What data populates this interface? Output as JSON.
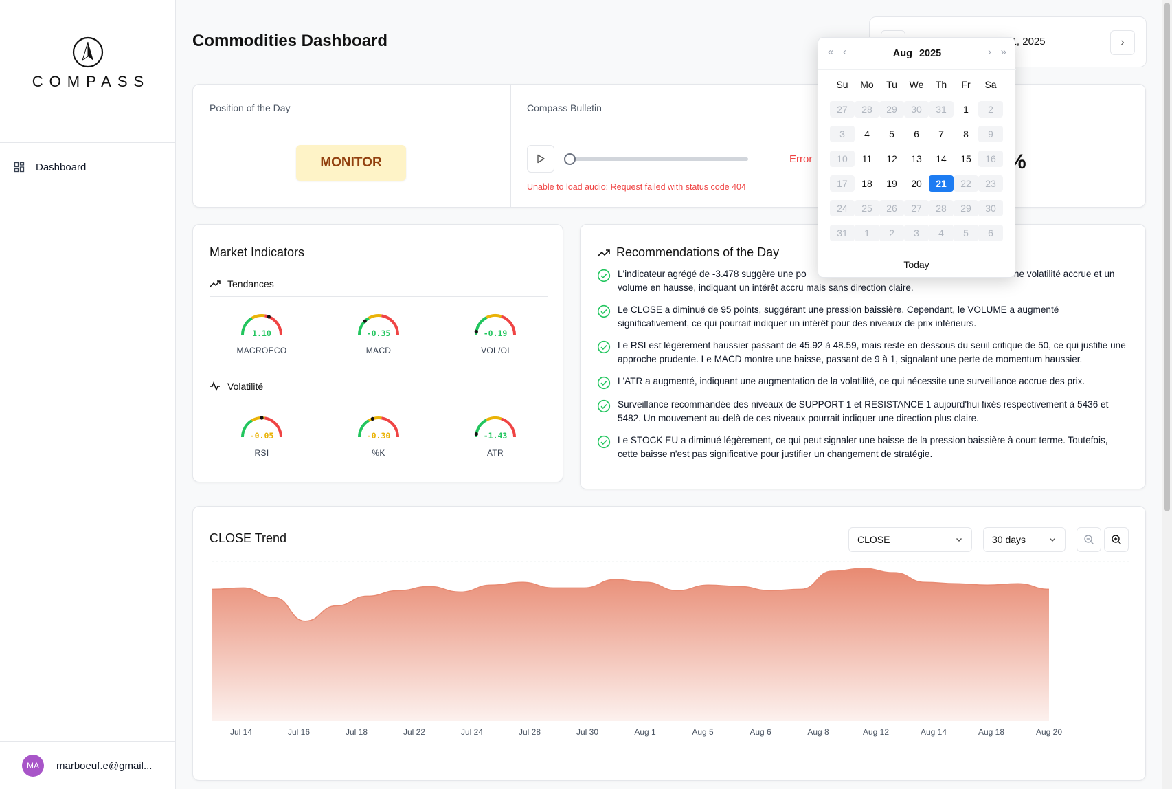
{
  "sidebar": {
    "brand": "COMPASS",
    "nav": [
      {
        "label": "Dashboard",
        "icon": "dashboard-grid-icon"
      }
    ],
    "user": {
      "initials": "MA",
      "email": "marboeuf.e@gmail..."
    }
  },
  "header": {
    "title": "Commodities Dashboard",
    "date": "August 21, 2025"
  },
  "top": {
    "position_label": "Position of the Day",
    "position_value": "MONITOR",
    "bulletin_label": "Compass Bulletin",
    "audio_status": "Error",
    "audio_error": "Unable to load audio: Request failed with status code 404",
    "partial_value": "%"
  },
  "market": {
    "title": "Market Indicators",
    "sections": [
      {
        "title": "Tendances",
        "icon": "trend-up-icon",
        "gauges": [
          {
            "label": "MACROECO",
            "value": "1.10",
            "level": 0.62,
            "color": "#22c55e"
          },
          {
            "label": "MACD",
            "value": "-0.35",
            "level": 0.25,
            "color": "#22c55e"
          },
          {
            "label": "VOL/OI",
            "value": "-0.19",
            "level": 0.05,
            "color": "#22c55e"
          }
        ]
      },
      {
        "title": "Volatilité",
        "icon": "activity-icon",
        "gauges": [
          {
            "label": "RSI",
            "value": "-0.05",
            "level": 0.5,
            "color": "#eab308"
          },
          {
            "label": "%K",
            "value": "-0.30",
            "level": 0.4,
            "color": "#eab308"
          },
          {
            "label": "ATR",
            "value": "-1.43",
            "level": 0.05,
            "color": "#22c55e"
          }
        ]
      }
    ]
  },
  "recommendations": {
    "title": "Recommendations of the Day",
    "items": [
      "L'indicateur agrégé de -3.478 suggère une po                                                données montrent une volatilité accrue et un volume en hausse, indiquant un intérêt accru mais sans direction claire.",
      "Le CLOSE a diminué de 95 points, suggérant une pression baissière. Cependant, le VOLUME a augmenté significativement, ce qui pourrait indiquer un intérêt pour des niveaux de prix inférieurs.",
      "Le RSI est légèrement haussier passant de 45.92 à 48.59, mais reste en dessous du seuil critique de 50, ce qui justifie une approche prudente. Le MACD montre une baisse, passant de 9 à 1, signalant une perte de momentum haussier.",
      "L'ATR a augmenté, indiquant une augmentation de la volatilité, ce qui nécessite une surveillance accrue des prix.",
      "Surveillance recommandée des niveaux de SUPPORT 1 et RESISTANCE 1 aujourd'hui fixés respectivement à 5436 et 5482. Un mouvement au-delà de ces niveaux pourrait indiquer une direction plus claire.",
      "Le STOCK EU a diminué légèrement, ce qui peut signaler une baisse de la pression baissière à court terme. Toutefois, cette baisse n'est pas significative pour justifier un changement de stratégie."
    ]
  },
  "trend": {
    "title": "CLOSE Trend",
    "metric": "CLOSE",
    "range": "30 days"
  },
  "chart_data": {
    "type": "area",
    "x": [
      "Jul 14",
      "Jul 15",
      "Jul 16",
      "Jul 17",
      "Jul 18",
      "Jul 21",
      "Jul 22",
      "Jul 23",
      "Jul 24",
      "Jul 25",
      "Jul 28",
      "Jul 29",
      "Jul 30",
      "Jul 31",
      "Aug 1",
      "Aug 4",
      "Aug 5",
      "Aug 6",
      "Aug 7",
      "Aug 8",
      "Aug 11",
      "Aug 12",
      "Aug 13",
      "Aug 14",
      "Aug 15",
      "Aug 18",
      "Aug 19",
      "Aug 20"
    ],
    "tick_labels": [
      "Jul 14",
      "Jul 16",
      "Jul 18",
      "Jul 22",
      "Jul 24",
      "Jul 28",
      "Jul 30",
      "Aug 1",
      "Aug 5",
      "Aug 6",
      "Aug 8",
      "Aug 12",
      "Aug 14",
      "Aug 18",
      "Aug 20"
    ],
    "values": [
      5475,
      5476,
      5469,
      5452,
      5463,
      5470,
      5474,
      5477,
      5473,
      5478,
      5480,
      5476,
      5476,
      5482,
      5480,
      5474,
      5478,
      5477,
      5474,
      5475,
      5488,
      5490,
      5487,
      5480,
      5479,
      5478,
      5479,
      5475
    ],
    "ylim": [
      5380,
      5495
    ],
    "color": "#e88a72",
    "grid": false
  },
  "calendar": {
    "month": "Aug",
    "year": "2025",
    "dow": [
      "Su",
      "Mo",
      "Tu",
      "We",
      "Th",
      "Fr",
      "Sa"
    ],
    "weeks": [
      [
        {
          "d": "27",
          "s": "out"
        },
        {
          "d": "28",
          "s": "out"
        },
        {
          "d": "29",
          "s": "out"
        },
        {
          "d": "30",
          "s": "out"
        },
        {
          "d": "31",
          "s": "out"
        },
        {
          "d": "1",
          "s": "in"
        },
        {
          "d": "2",
          "s": "out"
        }
      ],
      [
        {
          "d": "3",
          "s": "out"
        },
        {
          "d": "4",
          "s": "in"
        },
        {
          "d": "5",
          "s": "in"
        },
        {
          "d": "6",
          "s": "in"
        },
        {
          "d": "7",
          "s": "in"
        },
        {
          "d": "8",
          "s": "in"
        },
        {
          "d": "9",
          "s": "out"
        }
      ],
      [
        {
          "d": "10",
          "s": "out"
        },
        {
          "d": "11",
          "s": "in"
        },
        {
          "d": "12",
          "s": "in"
        },
        {
          "d": "13",
          "s": "in"
        },
        {
          "d": "14",
          "s": "in"
        },
        {
          "d": "15",
          "s": "in"
        },
        {
          "d": "16",
          "s": "out"
        }
      ],
      [
        {
          "d": "17",
          "s": "out"
        },
        {
          "d": "18",
          "s": "in"
        },
        {
          "d": "19",
          "s": "in"
        },
        {
          "d": "20",
          "s": "in"
        },
        {
          "d": "21",
          "s": "sel"
        },
        {
          "d": "22",
          "s": "out"
        },
        {
          "d": "23",
          "s": "out"
        }
      ],
      [
        {
          "d": "24",
          "s": "out"
        },
        {
          "d": "25",
          "s": "out"
        },
        {
          "d": "26",
          "s": "out"
        },
        {
          "d": "27",
          "s": "out"
        },
        {
          "d": "28",
          "s": "out"
        },
        {
          "d": "29",
          "s": "out"
        },
        {
          "d": "30",
          "s": "out"
        }
      ],
      [
        {
          "d": "31",
          "s": "out"
        },
        {
          "d": "1",
          "s": "out"
        },
        {
          "d": "2",
          "s": "out"
        },
        {
          "d": "3",
          "s": "out"
        },
        {
          "d": "4",
          "s": "out"
        },
        {
          "d": "5",
          "s": "out"
        },
        {
          "d": "6",
          "s": "out"
        }
      ]
    ],
    "today_label": "Today"
  }
}
